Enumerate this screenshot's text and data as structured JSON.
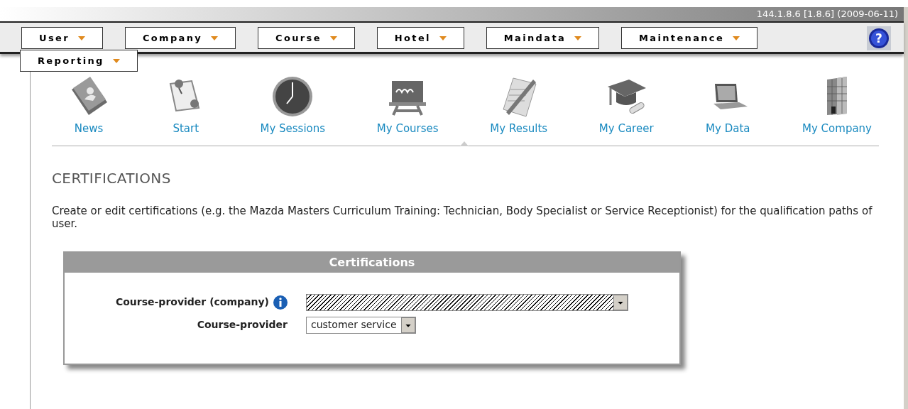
{
  "header": {
    "version": "144.1.8.6 [1.8.6] (2009-06-11)"
  },
  "help": "?",
  "menu": [
    {
      "label": "User"
    },
    {
      "label": "Company"
    },
    {
      "label": "Course"
    },
    {
      "label": "Hotel"
    },
    {
      "label": "Maindata"
    },
    {
      "label": "Maintenance"
    },
    {
      "label": "Reporting"
    }
  ],
  "nav": [
    {
      "label": "News",
      "kind": "book"
    },
    {
      "label": "Start",
      "kind": "pins"
    },
    {
      "label": "My Sessions",
      "kind": "clock"
    },
    {
      "label": "My Courses",
      "kind": "board"
    },
    {
      "label": "My Results",
      "kind": "paper"
    },
    {
      "label": "My Career",
      "kind": "cap"
    },
    {
      "label": "My Data",
      "kind": "laptop"
    },
    {
      "label": "My Company",
      "kind": "building"
    }
  ],
  "page": {
    "title": "CERTIFICATIONS",
    "description": "Create or edit certifications (e.g. the Mazda Masters Curriculum Training: Technician, Body Specialist or Service Receptionist) for the qualification paths of user."
  },
  "panel": {
    "title": "Certifications",
    "fields": [
      {
        "label": "Course-provider (company)",
        "info": true,
        "kind": "hatched"
      },
      {
        "label": "Course-provider",
        "info": false,
        "kind": "select",
        "value": "customer service"
      }
    ]
  }
}
